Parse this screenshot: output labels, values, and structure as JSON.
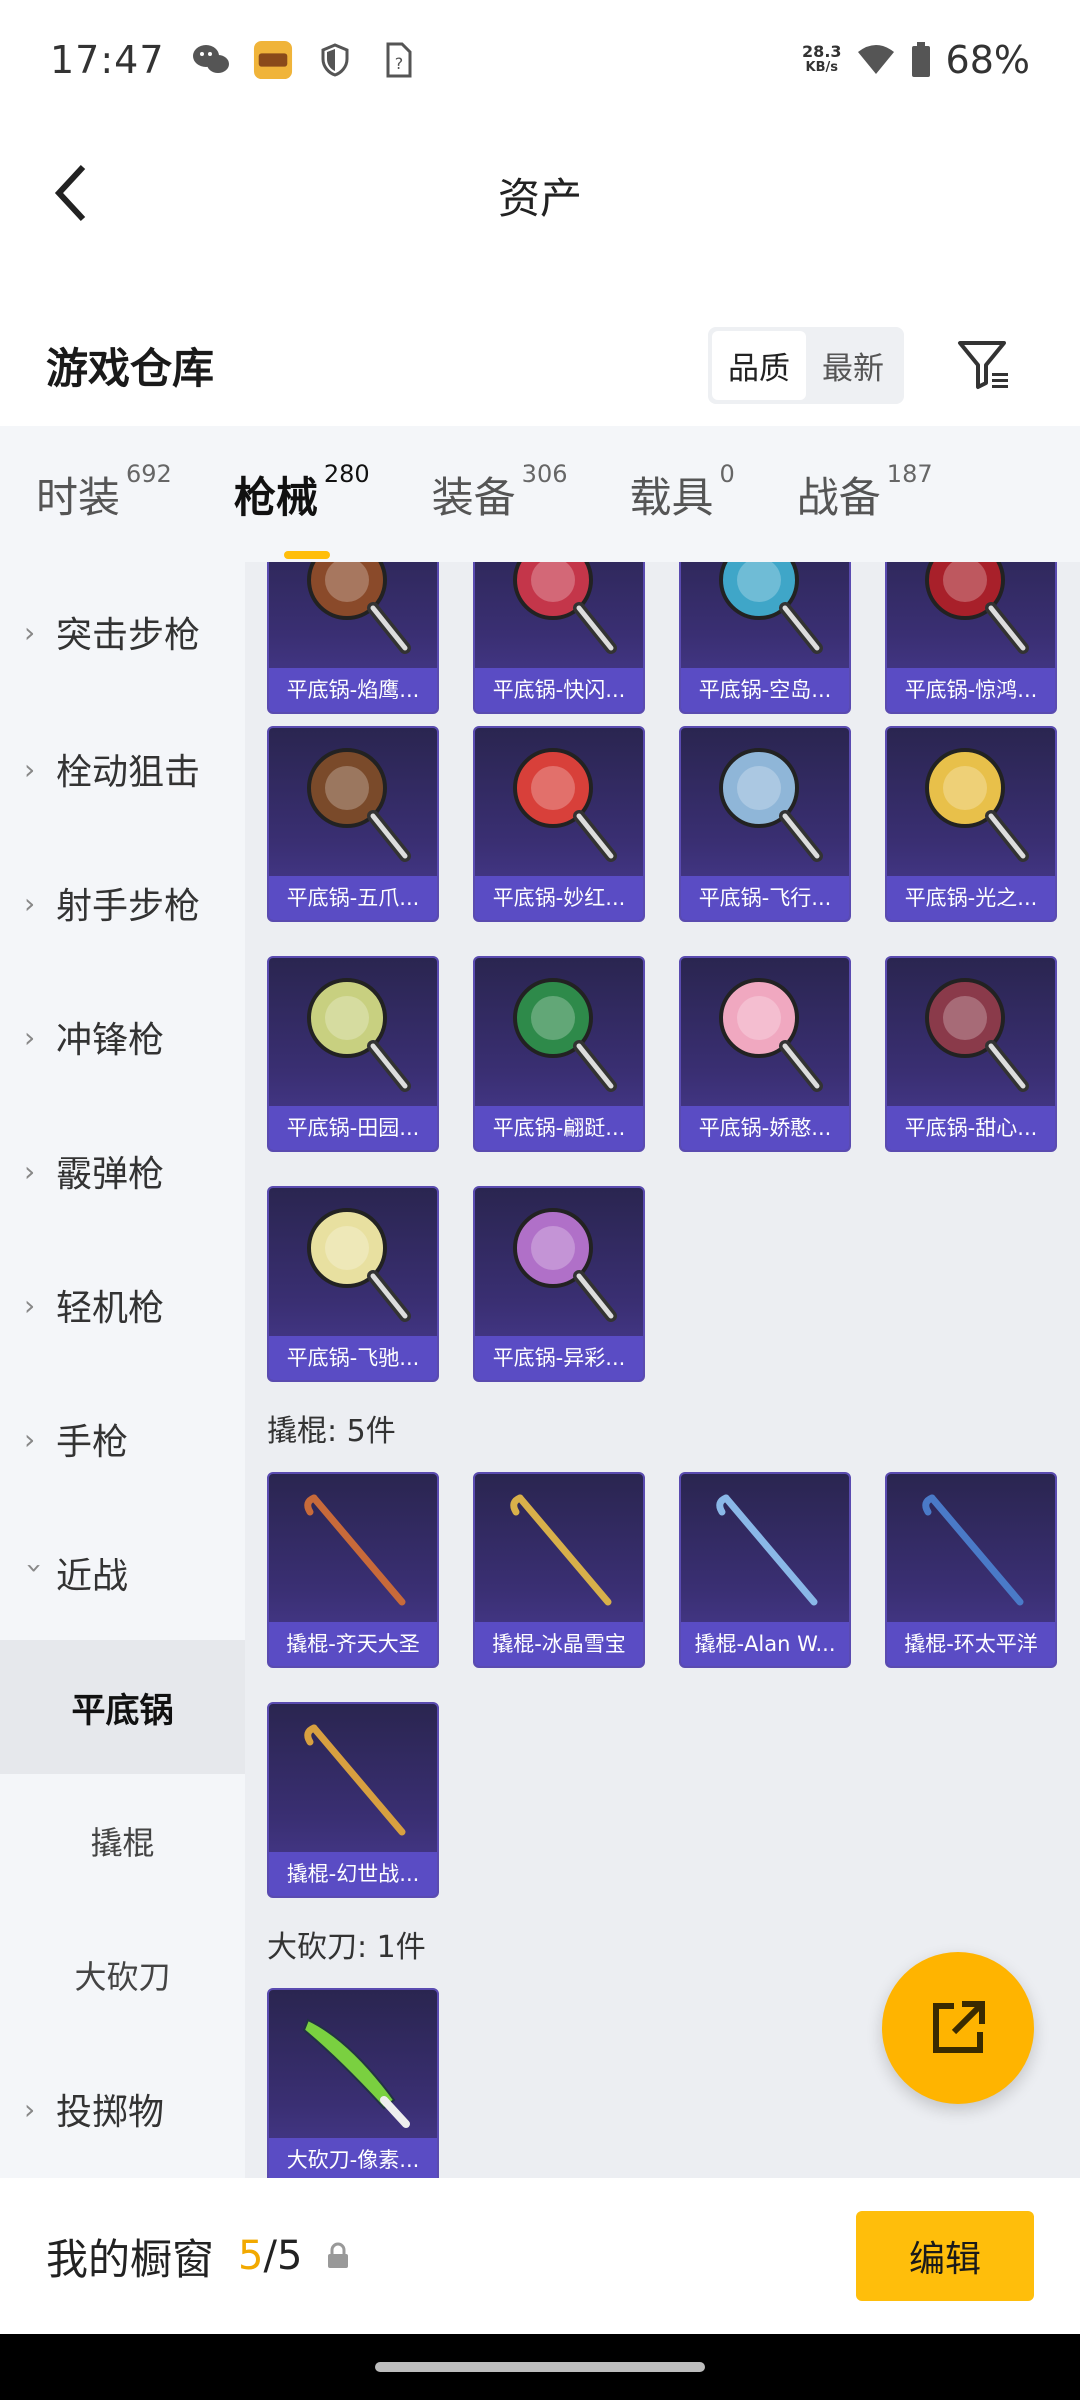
{
  "status_bar": {
    "time": "17:47",
    "speed_value": "28.3",
    "speed_unit": "KB/s",
    "battery": "68%",
    "icons": [
      "wechat-icon",
      "app-icon",
      "shield-icon",
      "unknown-sim-icon",
      "wifi-icon",
      "battery-icon"
    ]
  },
  "header": {
    "title": "资产"
  },
  "warehouse": {
    "title": "游戏仓库",
    "sort_options": [
      "品质",
      "最新"
    ],
    "sort_selected": "品质"
  },
  "tabs": [
    {
      "label": "时装",
      "count": "692"
    },
    {
      "label": "枪械",
      "count": "280",
      "active": true
    },
    {
      "label": "装备",
      "count": "306"
    },
    {
      "label": "载具",
      "count": "0"
    },
    {
      "label": "战备",
      "count": "187"
    }
  ],
  "sidebar": {
    "items": [
      {
        "label": "突击步枪"
      },
      {
        "label": "栓动狙击"
      },
      {
        "label": "射手步枪"
      },
      {
        "label": "冲锋枪"
      },
      {
        "label": "霰弹枪"
      },
      {
        "label": "轻机枪"
      },
      {
        "label": "手枪"
      },
      {
        "label": "近战"
      },
      {
        "label": "平底锅"
      },
      {
        "label": "撬棍"
      },
      {
        "label": "大砍刀"
      },
      {
        "label": "投掷物"
      }
    ]
  },
  "pans": [
    {
      "name": "平底锅-焰鹰...",
      "color": "#8a4a2a"
    },
    {
      "name": "平底锅-快闪...",
      "color": "#c4364a"
    },
    {
      "name": "平底锅-空岛...",
      "color": "#3fa6c8"
    },
    {
      "name": "平底锅-惊鸿...",
      "color": "#a8202a"
    },
    {
      "name": "平底锅-五爪...",
      "color": "#7a4a2a"
    },
    {
      "name": "平底锅-妙红...",
      "color": "#d8403a"
    },
    {
      "name": "平底锅-飞行...",
      "color": "#8fb6d8"
    },
    {
      "name": "平底锅-光之...",
      "color": "#e8c04a"
    },
    {
      "name": "平底锅-田园...",
      "color": "#c8d080"
    },
    {
      "name": "平底锅-翩跹...",
      "color": "#2e8a4a"
    },
    {
      "name": "平底锅-娇憨...",
      "color": "#f0a8c0"
    },
    {
      "name": "平底锅-甜心...",
      "color": "#8a3a4a"
    },
    {
      "name": "平底锅-飞驰...",
      "color": "#e8e0a0"
    },
    {
      "name": "平底锅-异彩...",
      "color": "#b070c8"
    }
  ],
  "crowbar_section": {
    "label": "撬棍: 5件"
  },
  "crowbars": [
    {
      "name": "撬棍-齐天大圣",
      "color": "#c86a3a"
    },
    {
      "name": "撬棍-冰晶雪宝",
      "color": "#d8b04a"
    },
    {
      "name": "撬棍-Alan W...",
      "color": "#8ab8e8"
    },
    {
      "name": "撬棍-环太平洋",
      "color": "#4a7ac8"
    },
    {
      "name": "撬棍-幻世战...",
      "color": "#d8a040"
    }
  ],
  "machete_section": {
    "label": "大砍刀: 1件"
  },
  "machetes": [
    {
      "name": "大砍刀-像素...",
      "color": "#7ad040"
    }
  ],
  "bottom_bar": {
    "title": "我的橱窗",
    "used": "5",
    "separator": "/",
    "total": "5",
    "edit_label": "编辑"
  },
  "colors": {
    "accent": "#ffbe0b",
    "card_bg": "#3a2f73",
    "card_label": "#5a4cc4"
  }
}
